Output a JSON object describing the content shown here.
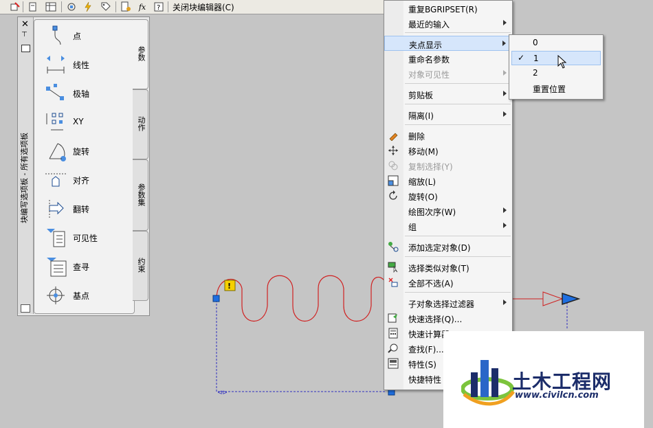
{
  "toolbar": {
    "close_editor_label": "关闭块编辑器(C)",
    "icons": [
      "block-editor-icon",
      "save-block-icon",
      "define-attribute-icon",
      "block-table-icon",
      "test-block-icon",
      "actions-icon",
      "parameter-sets-icon",
      "manage-icon",
      "fx-icon",
      "help-icon"
    ]
  },
  "palette": {
    "title": "块编写选项板 - 所有选项板",
    "items": [
      {
        "label": "点",
        "icon": "point-param-icon"
      },
      {
        "label": "线性",
        "icon": "linear-param-icon"
      },
      {
        "label": "极轴",
        "icon": "polar-param-icon"
      },
      {
        "label": "XY",
        "icon": "xy-param-icon"
      },
      {
        "label": "旋转",
        "icon": "rotation-param-icon"
      },
      {
        "label": "对齐",
        "icon": "alignment-param-icon"
      },
      {
        "label": "翻转",
        "icon": "flip-param-icon"
      },
      {
        "label": "可见性",
        "icon": "visibility-param-icon"
      },
      {
        "label": "查寻",
        "icon": "lookup-param-icon"
      },
      {
        "label": "基点",
        "icon": "basepoint-param-icon"
      }
    ],
    "tabs": [
      "参数",
      "动作",
      "参数集",
      "约束"
    ]
  },
  "menu": {
    "items": [
      {
        "label": "重复BGRIPSET(R)",
        "disabled": false,
        "submenu": false
      },
      {
        "label": "最近的输入",
        "disabled": false,
        "submenu": true
      },
      {
        "label": "夹点显示",
        "disabled": false,
        "submenu": true,
        "highlight": true
      },
      {
        "label": "重命名参数",
        "disabled": false,
        "submenu": false
      },
      {
        "label": "对象可见性",
        "disabled": true,
        "submenu": true
      },
      {
        "label": "剪贴板",
        "disabled": false,
        "submenu": true
      },
      {
        "label": "隔离(I)",
        "disabled": false,
        "submenu": true
      },
      {
        "label": "删除",
        "icon": "erase-icon"
      },
      {
        "label": "移动(M)",
        "icon": "move-icon"
      },
      {
        "label": "复制选择(Y)",
        "icon": "copy-icon",
        "disabled": true
      },
      {
        "label": "缩放(L)",
        "icon": "scale-icon"
      },
      {
        "label": "旋转(O)",
        "icon": "rotate-icon"
      },
      {
        "label": "绘图次序(W)",
        "submenu": true
      },
      {
        "label": "组",
        "submenu": true
      },
      {
        "label": "添加选定对象(D)",
        "icon": "add-selected-icon"
      },
      {
        "label": "选择类似对象(T)",
        "icon": "select-similar-icon"
      },
      {
        "label": "全部不选(A)",
        "icon": "deselect-all-icon"
      },
      {
        "label": "子对象选择过滤器",
        "submenu": true
      },
      {
        "label": "快速选择(Q)...",
        "icon": "quick-select-icon"
      },
      {
        "label": "快速计算器",
        "icon": "calculator-icon"
      },
      {
        "label": "查找(F)...",
        "icon": "find-icon"
      },
      {
        "label": "特性(S)",
        "icon": "properties-icon"
      },
      {
        "label": "快捷特性",
        "icon": ""
      }
    ]
  },
  "submenu": {
    "items": [
      {
        "label": "0",
        "checked": false
      },
      {
        "label": "1",
        "checked": true,
        "highlight": true
      },
      {
        "label": "2",
        "checked": false
      },
      {
        "label": "重置位置",
        "checked": false
      }
    ],
    "check_mark": "✓"
  },
  "watermark": {
    "title": "土木工程网",
    "url": "www.civilcn.com"
  },
  "colors": {
    "grip_blue": "#1f6fe0",
    "spring_red": "#d02020",
    "selection_blue": "#3030c0",
    "highlight_bg": "#d6e6fb",
    "watermark_navy": "#1c2d6a"
  }
}
